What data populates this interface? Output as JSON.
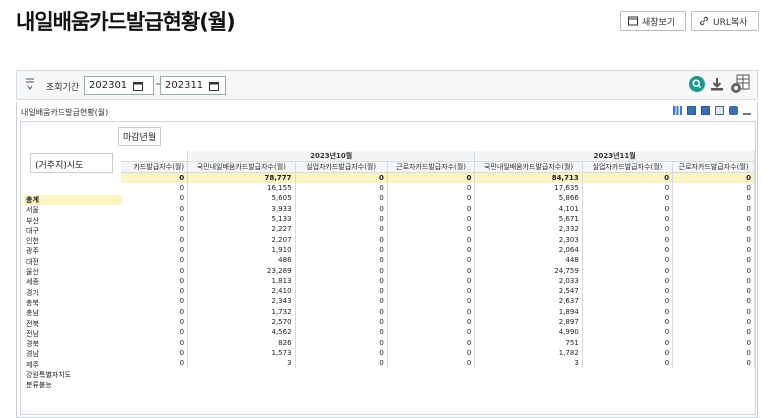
{
  "page_title": "내일배움카드발급현황(월)",
  "buttons": {
    "new_window": "새창보기",
    "url_copy": "URL복사"
  },
  "search": {
    "label": "조회기간",
    "from": "202301",
    "to": "202311",
    "separator": "~"
  },
  "panel_title": "내일배움카드발급현황(월)",
  "pivot": {
    "column_field": "마감년월",
    "row_field": "(거주지)시도",
    "partial_first_col": "카드발급자수(월)",
    "months": [
      "2023년10월",
      "2023년11월"
    ],
    "col_headers": [
      "국민내일배움카드발급자수(월)",
      "실업자카드발급자수(월)",
      "근로자카드발급자수(월)"
    ],
    "rows": [
      {
        "name": "총계",
        "v": [
          "0",
          "78,777",
          "0",
          "0",
          "84,713",
          "0",
          "0"
        ]
      },
      {
        "name": "서울",
        "v": [
          "0",
          "16,155",
          "0",
          "0",
          "17,635",
          "0",
          "0"
        ]
      },
      {
        "name": "부산",
        "v": [
          "0",
          "5,605",
          "0",
          "0",
          "5,866",
          "0",
          "0"
        ]
      },
      {
        "name": "대구",
        "v": [
          "0",
          "3,933",
          "0",
          "0",
          "4,101",
          "0",
          "0"
        ]
      },
      {
        "name": "인천",
        "v": [
          "0",
          "5,133",
          "0",
          "0",
          "5,671",
          "0",
          "0"
        ]
      },
      {
        "name": "광주",
        "v": [
          "0",
          "2,227",
          "0",
          "0",
          "2,332",
          "0",
          "0"
        ]
      },
      {
        "name": "대전",
        "v": [
          "0",
          "2,207",
          "0",
          "0",
          "2,303",
          "0",
          "0"
        ]
      },
      {
        "name": "울산",
        "v": [
          "0",
          "1,910",
          "0",
          "0",
          "2,064",
          "0",
          "0"
        ]
      },
      {
        "name": "세종",
        "v": [
          "0",
          "486",
          "0",
          "0",
          "448",
          "0",
          "0"
        ]
      },
      {
        "name": "경기",
        "v": [
          "0",
          "23,289",
          "0",
          "0",
          "24,759",
          "0",
          "0"
        ]
      },
      {
        "name": "충북",
        "v": [
          "0",
          "1,813",
          "0",
          "0",
          "2,033",
          "0",
          "0"
        ]
      },
      {
        "name": "충남",
        "v": [
          "0",
          "2,410",
          "0",
          "0",
          "2,547",
          "0",
          "0"
        ]
      },
      {
        "name": "전북",
        "v": [
          "0",
          "2,343",
          "0",
          "0",
          "2,637",
          "0",
          "0"
        ]
      },
      {
        "name": "전남",
        "v": [
          "0",
          "1,732",
          "0",
          "0",
          "1,894",
          "0",
          "0"
        ]
      },
      {
        "name": "경북",
        "v": [
          "0",
          "2,570",
          "0",
          "0",
          "2,897",
          "0",
          "0"
        ]
      },
      {
        "name": "경남",
        "v": [
          "0",
          "4,562",
          "0",
          "0",
          "4,990",
          "0",
          "0"
        ]
      },
      {
        "name": "제주",
        "v": [
          "0",
          "826",
          "0",
          "0",
          "751",
          "0",
          "0"
        ]
      },
      {
        "name": "강원특별자치도",
        "v": [
          "0",
          "1,573",
          "0",
          "0",
          "1,782",
          "0",
          "0"
        ]
      },
      {
        "name": "분류불능",
        "v": [
          "0",
          "3",
          "0",
          "0",
          "3",
          "0",
          "0"
        ]
      }
    ]
  }
}
